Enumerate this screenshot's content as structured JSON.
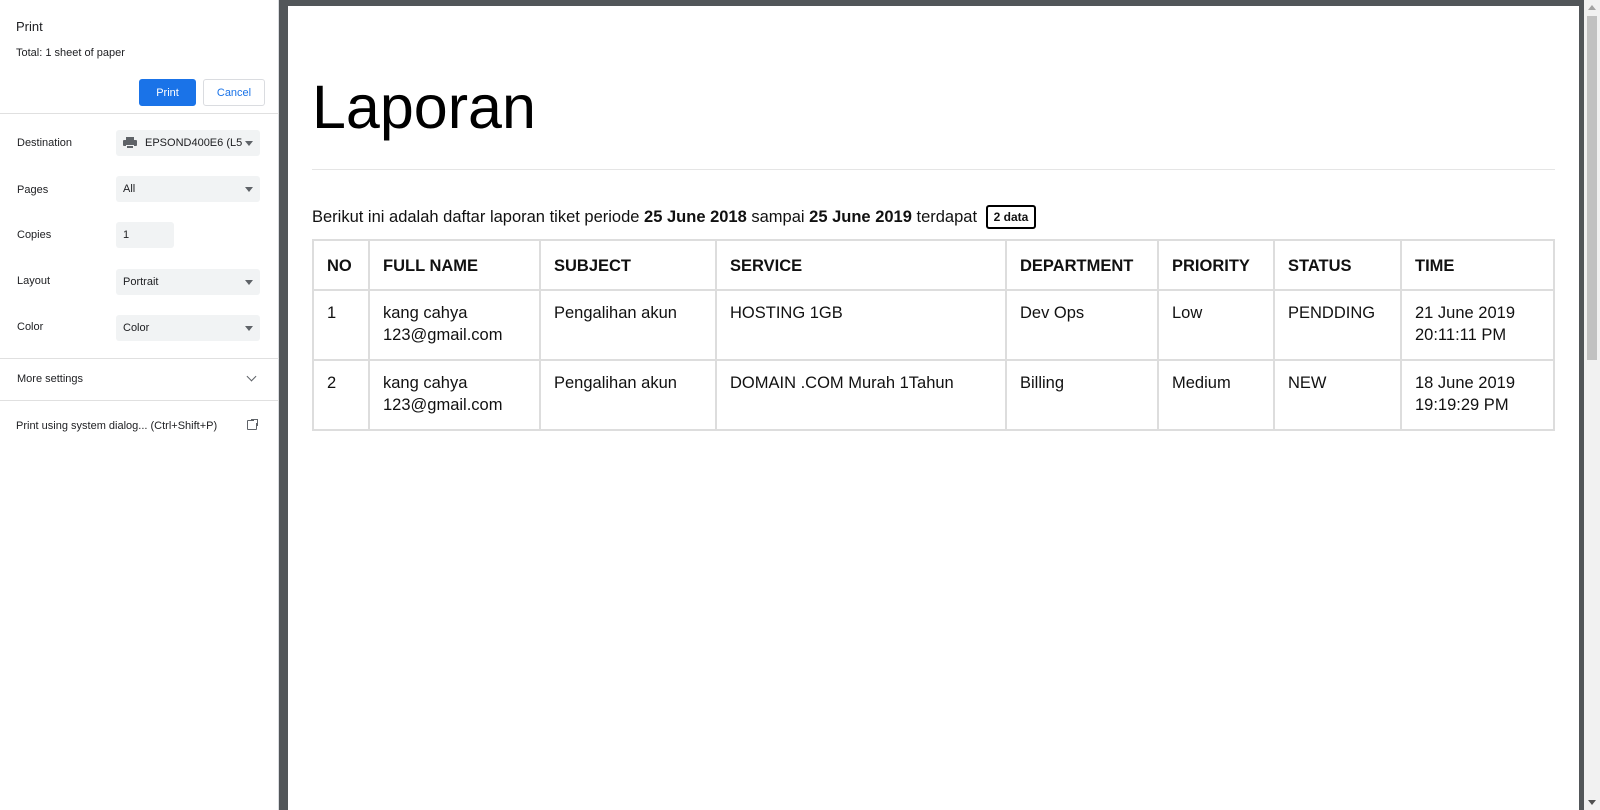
{
  "panel": {
    "title": "Print",
    "total": "Total: 1 sheet of paper",
    "print_label": "Print",
    "cancel_label": "Cancel",
    "destination": {
      "label": "Destination",
      "value": "EPSOND400E6 (L5"
    },
    "pages": {
      "label": "Pages",
      "value": "All"
    },
    "copies": {
      "label": "Copies",
      "value": "1"
    },
    "layout": {
      "label": "Layout",
      "value": "Portrait"
    },
    "color": {
      "label": "Color",
      "value": "Color"
    },
    "more_settings": "More settings",
    "system_dialog": "Print using system dialog... (Ctrl+Shift+P)"
  },
  "document": {
    "title": "Laporan",
    "intro_prefix": "Berikut ini adalah daftar laporan tiket periode ",
    "date_from": "25 June 2018",
    "intro_mid": " sampai ",
    "date_to": "25 June 2019",
    "intro_suffix": " terdapat ",
    "badge": "2 data",
    "columns": [
      "NO",
      "FULL NAME",
      "SUBJECT",
      "SERVICE",
      "DEPARTMENT",
      "PRIORITY",
      "STATUS",
      "TIME"
    ],
    "rows": [
      {
        "no": "1",
        "name_line1": "kang cahya",
        "name_line2": "123@gmail.com",
        "subject": "Pengalihan akun",
        "service": "HOSTING 1GB",
        "department": "Dev Ops",
        "priority": "Low",
        "status": "PENDDING",
        "time_line1": "21 June 2019",
        "time_line2": "20:11:11 PM"
      },
      {
        "no": "2",
        "name_line1": "kang cahya",
        "name_line2": "123@gmail.com",
        "subject": "Pengalihan akun",
        "service": "DOMAIN .COM Murah 1Tahun",
        "department": "Billing",
        "priority": "Medium",
        "status": "NEW",
        "time_line1": "18 June 2019",
        "time_line2": "19:19:29 PM"
      }
    ]
  },
  "colors": {
    "accent": "#1a73e8",
    "preview_background": "#525659"
  }
}
